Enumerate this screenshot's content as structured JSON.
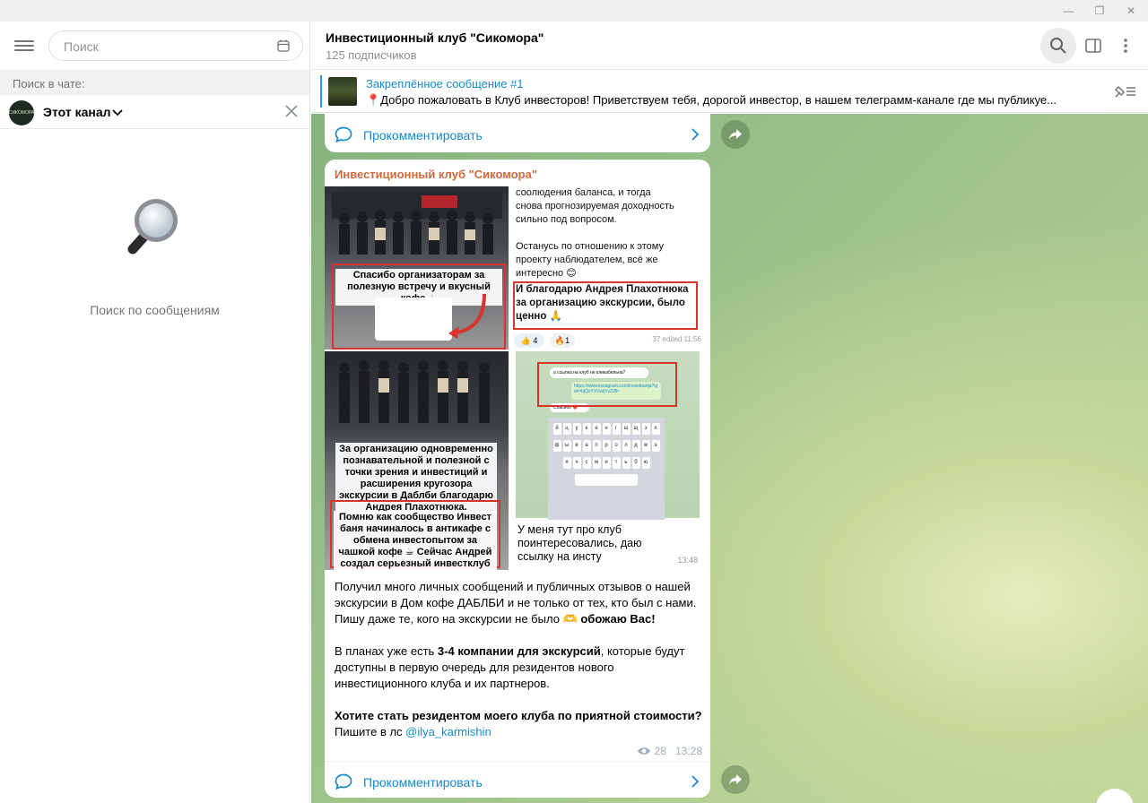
{
  "window": {
    "minimize": "—",
    "restore": "❐",
    "close": "✕"
  },
  "sidebar": {
    "search_placeholder": "Поиск",
    "search_in_chat": "Поиск в чате:",
    "scope": "Этот канал",
    "scope_avatar_text": "СИКОМОРА",
    "empty_text": "Поиск по сообщениям"
  },
  "chat": {
    "title": "Инвестиционный клуб \"Сикомора\"",
    "subscribers": "125 подписчиков"
  },
  "pinned": {
    "title": "Закреплённое сообщение #1",
    "text": "📍Добро пожаловать в Клуб инвесторов!   Приветствуем тебя, дорогой инвестор, в нашем телеграмм-канале где мы публикуе..."
  },
  "comment_label": "Прокомментировать",
  "post": {
    "author": "Инвестиционный клуб \"Сикомора\"",
    "photo1_caption": "Спасибо организаторам за полезную встречу и вкусный кофе ☕",
    "photo2_lines": [
      "соолюдения баланса, и тогда",
      "снова прогнозируемая доходность",
      "сильно под вопросом.",
      "",
      "Останусь по отношению к этому",
      "проекту наблюдателем, всё же",
      "интересно 😊"
    ],
    "photo2_bold": "И благодарю Андрея Плахотнюка за организацию экскурсии, было ценно 🙏",
    "photo2_meta": "37 edited 11:56",
    "photo3_caption1": "За организацию одновременно познавательной и полезной с точки зрения и инвестиций и расширения кругозора экскурсии в Даблби благодарю Андрея Плахотнюка.",
    "photo3_caption2": "Помню как сообщество Инвест баня начиналось в антикафе с обмена инвестопытом за чашкой кофе ☕ Сейчас Андрей создал серьезный инвестклуб",
    "photo4_bubble": "У меня тут про клуб поинтересовались, даю ссылку на инсту",
    "photo4_time": "13:48",
    "photo4_q": "а ссылка на клуб не кликабельна?",
    "photo4_link": "https://www.instagram.com/investbanja?igsh=bjQzYXVwljVzZ2lh",
    "photo4_thanks": "Спасибо ❤️",
    "text_p1": "Получил много личных сообщений  и публичных отзывов о нашей экскурсии в Дом кофе ДАБЛБИ и не только от тех, кто был с нами. Пишу даже те, кого на экскурсии не было 🫶 ",
    "text_p1_bold": "обожаю Вас!",
    "text_p2_a": "В планах уже есть ",
    "text_p2_bold": "3-4 компании для экскурсий",
    "text_p2_b": ", которые будут доступны в первую очередь для резидентов нового инвестиционного клуба и их партнеров.",
    "text_p3_bold": "Хотите стать резидентом моего клуба по приятной стоимости?",
    "text_p3_a": " Пишите в лс ",
    "text_p3_link": "@ilya_karmishin",
    "views": "28",
    "time": "13:28"
  },
  "colors": {
    "accent": "#168acd",
    "author": "#d1683c",
    "highlight_box": "#d8342b"
  }
}
